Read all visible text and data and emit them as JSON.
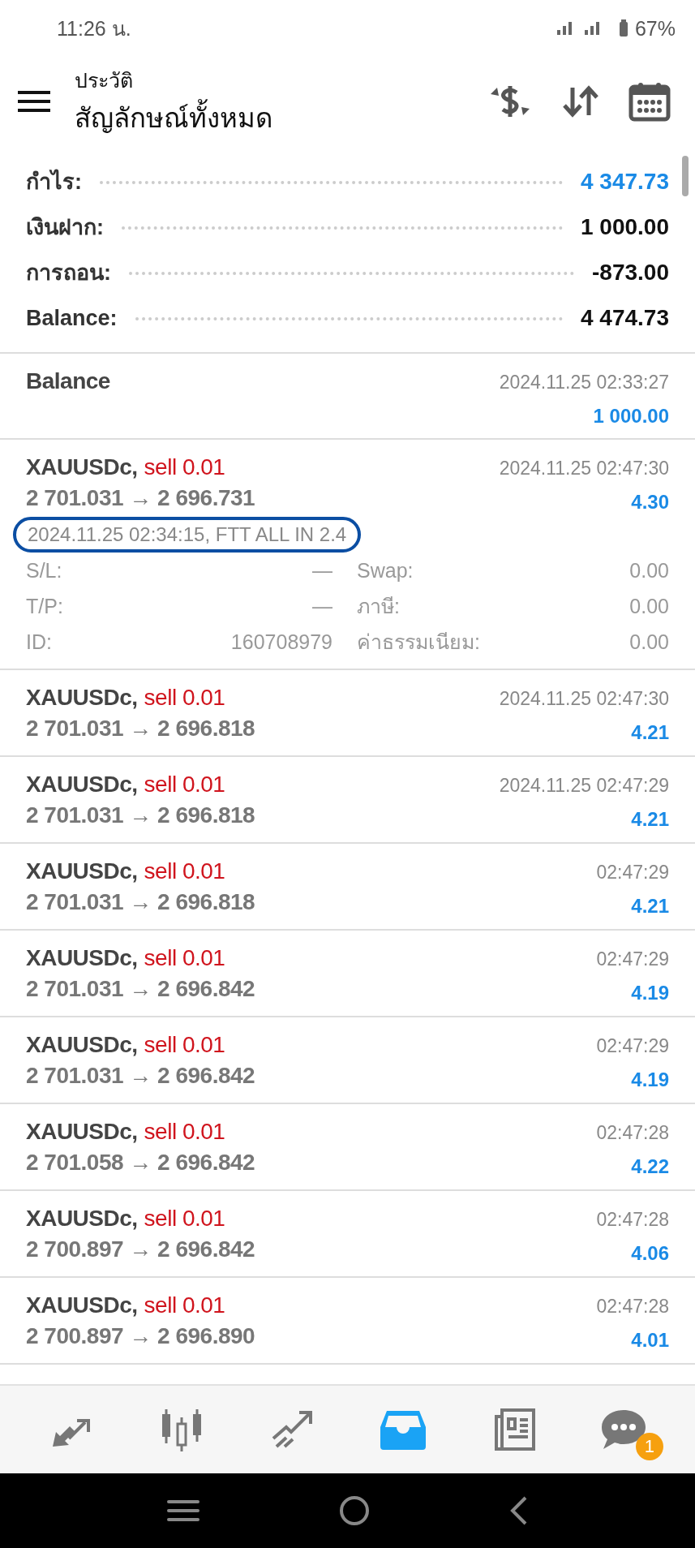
{
  "status_bar": {
    "time": "11:26 น.",
    "battery": "67%"
  },
  "header": {
    "subtitle": "ประวัติ",
    "title": "สัญลักษณ์ทั้งหมด"
  },
  "summary": [
    {
      "label": "กำไร:",
      "value": "4 347.73",
      "accent": true
    },
    {
      "label": "เงินฝาก:",
      "value": "1 000.00",
      "accent": false
    },
    {
      "label": "การถอน:",
      "value": "-873.00",
      "accent": false
    },
    {
      "label": "Balance:",
      "value": "4 474.73",
      "accent": false
    }
  ],
  "balance_entry": {
    "label": "Balance",
    "time": "2024.11.25 02:33:27",
    "amount": "1 000.00"
  },
  "expanded_deal": {
    "symbol": "XAUUSDc,",
    "side": "sell",
    "volume": "0.01",
    "prices": "2 701.031 → 2 696.731",
    "time": "2024.11.25 02:47:30",
    "profit": "4.30",
    "comment": "2024.11.25 02:34:15, FTT ALL IN 2.4",
    "highlighted": true,
    "details": [
      {
        "label": "S/L:",
        "value": "—",
        "label_2": "Swap:",
        "value_2": "0.00"
      },
      {
        "label": "T/P:",
        "value": "—",
        "label_2": "ภาษี:",
        "value_2": "0.00"
      },
      {
        "label": "ID:",
        "value": "160708979",
        "label_2": "ค่าธรรมเนียม:",
        "value_2": "0.00"
      }
    ]
  },
  "deals": [
    {
      "symbol": "XAUUSDc,",
      "side": "sell",
      "volume": "0.01",
      "prices": "2 701.031 → 2 696.818",
      "time": "2024.11.25 02:47:30",
      "profit": "4.21"
    },
    {
      "symbol": "XAUUSDc,",
      "side": "sell",
      "volume": "0.01",
      "prices": "2 701.031 → 2 696.818",
      "time": "2024.11.25 02:47:29",
      "profit": "4.21"
    },
    {
      "symbol": "XAUUSDc,",
      "side": "sell",
      "volume": "0.01",
      "prices": "2 701.031 → 2 696.818",
      "time": "02:47:29",
      "profit": "4.21"
    },
    {
      "symbol": "XAUUSDc,",
      "side": "sell",
      "volume": "0.01",
      "prices": "2 701.031 → 2 696.842",
      "time": "02:47:29",
      "profit": "4.19"
    },
    {
      "symbol": "XAUUSDc,",
      "side": "sell",
      "volume": "0.01",
      "prices": "2 701.031 → 2 696.842",
      "time": "02:47:29",
      "profit": "4.19"
    },
    {
      "symbol": "XAUUSDc,",
      "side": "sell",
      "volume": "0.01",
      "prices": "2 701.058 → 2 696.842",
      "time": "02:47:28",
      "profit": "4.22"
    },
    {
      "symbol": "XAUUSDc,",
      "side": "sell",
      "volume": "0.01",
      "prices": "2 700.897 → 2 696.842",
      "time": "02:47:28",
      "profit": "4.06"
    },
    {
      "symbol": "XAUUSDc,",
      "side": "sell",
      "volume": "0.01",
      "prices": "2 700.897 → 2 696.890",
      "time": "02:47:28",
      "profit": "4.01"
    }
  ],
  "bottom_nav": [
    {
      "kind": "trade",
      "selected": false
    },
    {
      "kind": "quotes",
      "selected": false
    },
    {
      "kind": "chart",
      "selected": false
    },
    {
      "kind": "history",
      "selected": true
    },
    {
      "kind": "news",
      "selected": false
    },
    {
      "kind": "chat",
      "selected": false,
      "badge": "1"
    }
  ]
}
